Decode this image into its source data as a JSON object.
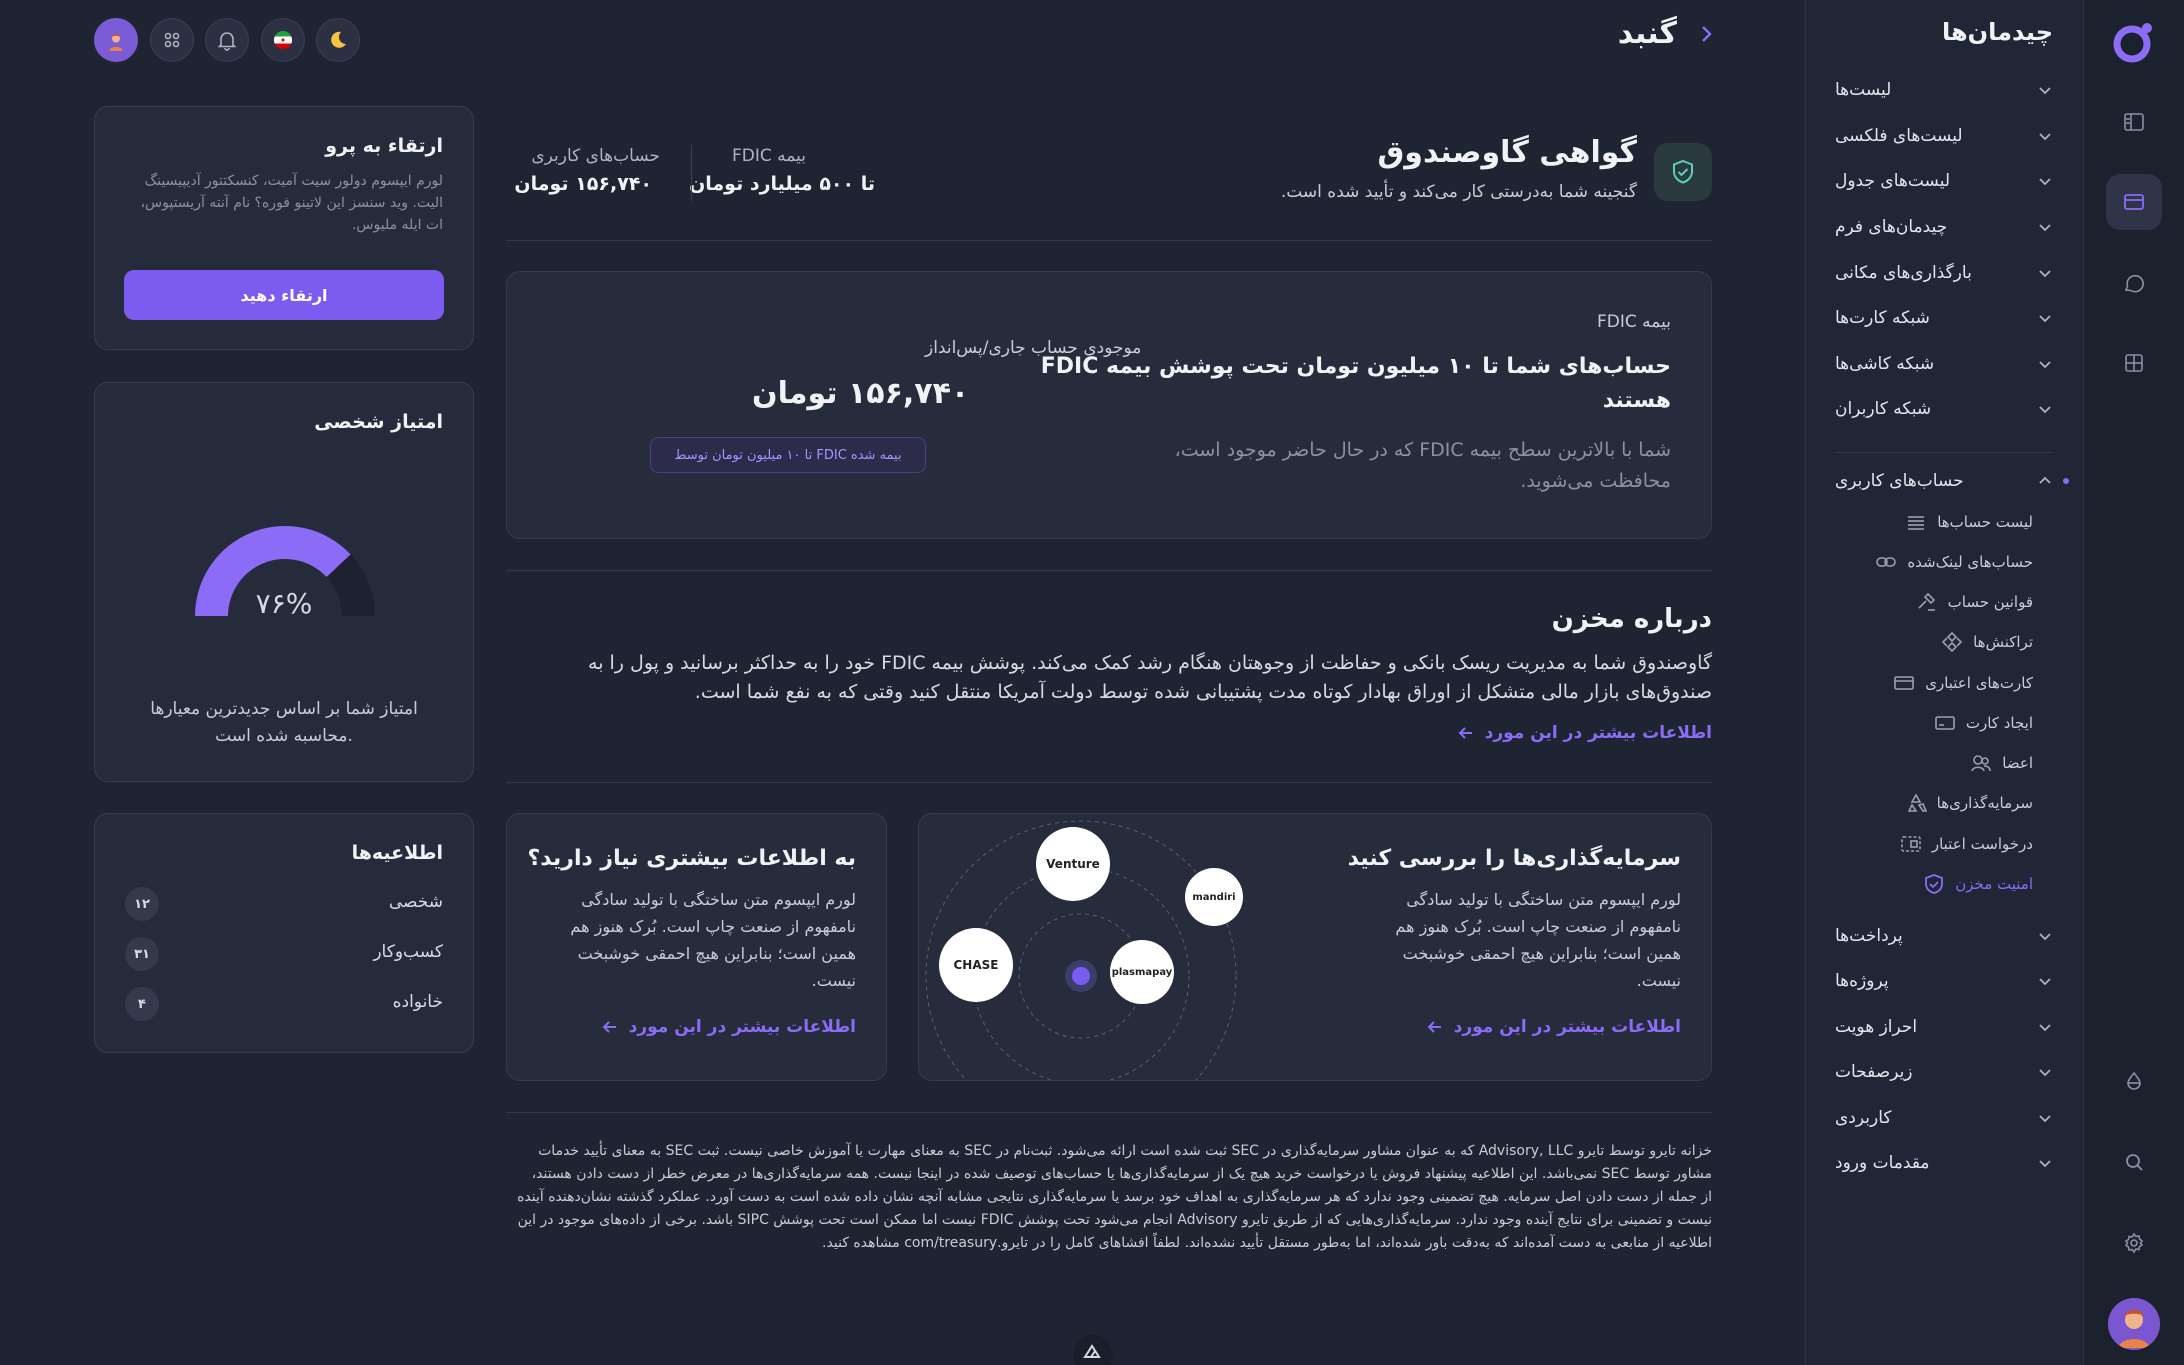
{
  "app": {
    "brand_color": "#8b6cf6"
  },
  "rail": {
    "icons": [
      "logo-icon",
      "layout-icon",
      "card-icon",
      "chat-icon",
      "grid-icon",
      "drop-icon",
      "search-icon",
      "settings-icon",
      "user-avatar"
    ]
  },
  "sidebar": {
    "title": "چیدمان‌ها",
    "items": [
      {
        "label": "لیست‌ها"
      },
      {
        "label": "لیست‌های فلکسی"
      },
      {
        "label": "لیست‌های جدول"
      },
      {
        "label": "چیدمان‌های فرم"
      },
      {
        "label": "بارگذاری‌های مکانی"
      },
      {
        "label": "شبکه کارت‌ها"
      },
      {
        "label": "شبکه کاشی‌ها"
      },
      {
        "label": "شبکه کاربران"
      }
    ],
    "open_group": {
      "label": "حساب‌های کاربری",
      "subitems": [
        {
          "label": "لیست حساب‌ها"
        },
        {
          "label": "حساب‌های لینک‌شده"
        },
        {
          "label": "قوانین حساب"
        },
        {
          "label": "تراکنش‌ها"
        },
        {
          "label": "کارت‌های اعتباری"
        },
        {
          "label": "ایجاد کارت"
        },
        {
          "label": "اعضا"
        },
        {
          "label": "سرمایه‌گذاری‌ها"
        },
        {
          "label": "درخواست اعتبار"
        },
        {
          "label": "امنیت مخزن"
        }
      ]
    },
    "bottom_items": [
      {
        "label": "پرداخت‌ها"
      },
      {
        "label": "پروژه‌ها"
      },
      {
        "label": "احراز هویت"
      },
      {
        "label": "زیرصفحات"
      },
      {
        "label": "کاربردی"
      },
      {
        "label": "مقدمات ورود"
      }
    ]
  },
  "header": {
    "title": "گنبد"
  },
  "certificate": {
    "title": "گواهی گاوصندوق",
    "subtitle": "گنجینه شما به‌درستی کار می‌کند و تأیید شده است.",
    "stat1_label": "بیمه FDIC",
    "stat1_value": "تا ۵۰۰ میلیارد تومان",
    "stat2_label": "حساب‌های کاربری",
    "stat2_value": "۱۵۶,۷۴۰ تومان"
  },
  "fdic": {
    "tag": "بیمه FDIC",
    "heading_line1": "حساب‌های شما تا ۱۰ میلیون تومان تحت پوشش بیمه FDIC",
    "heading_line2": "هستند",
    "desc_line1": "شما با بالاترین سطح بیمه FDIC که در حال حاضر موجود است،",
    "desc_line2": "محافظت می‌شوید.",
    "balance_label": "موجودی حساب جاری/پس‌انداز",
    "balance_value": "۱۵۶,۷۴۰ تومان",
    "pill": "تا ۱۰ میلیون تومان توسط FDIC بیمه شده"
  },
  "about": {
    "title": "درباره مخزن",
    "line1": "گاوصندوق شما به مدیریت ریسک بانکی و حفاظت از وجوهتان هنگام رشد کمک می‌کند. پوشش بیمه FDIC خود را به حداکثر برسانید و پول را به",
    "line2": "صندوق‌های بازار مالی متشکل از اوراق بهادار کوتاه مدت پشتیبانی شده توسط دولت آمریکا منتقل کنید وقتی که به نفع شما است.",
    "link": "اطلاعات بیشتر در این مورد"
  },
  "investments": {
    "title": "سرمایه‌گذاری‌ها را بررسی کنید",
    "l1": "لورم ایپسوم متن ساختگی با تولید سادگی",
    "l2": "نامفهوم از صنعت چاپ است. بُرک هنوز هم",
    "l3": "همین است؛ بنابراین هیچ احمقی خوشبخت",
    "l4": "نیست.",
    "link": "اطلاعات بیشتر در این مورد",
    "logos": [
      "Venture",
      "mandiri",
      "CHASE",
      "plasmapay"
    ]
  },
  "more_info": {
    "title": "به اطلاعات بیشتری نیاز دارید؟",
    "l1": "لورم ایپسوم متن ساختگی با تولید سادگی",
    "l2": "نامفهوم از صنعت چاپ است. بُرک هنوز هم",
    "l3": "همین است؛ بنابراین هیچ احمقی خوشبخت",
    "l4": "نیست.",
    "link": "اطلاعات بیشتر در این مورد"
  },
  "upgrade": {
    "title": "ارتقاء به پرو",
    "l1": "لورم ایپسوم دولور سیت آمیت، کنسکتتور آدیپیسینگ",
    "l2": "الیت. وید سنسز این لاتینو فوره؟ نام آنته آریستپوس،",
    "l3": "ات ایله ملیوس.",
    "button": "ارتقاء دهید"
  },
  "score": {
    "title": "امتیاز شخصی",
    "percent_text": "۷۶%",
    "percent": 76,
    "desc_l1": "امتیاز شما بر اساس جدیدترین معیارها",
    "desc_l2": "محاسبه شده است."
  },
  "info": {
    "title": "اطلاعیه‌ها",
    "rows": [
      {
        "label": "شخصی",
        "count": "۱۲"
      },
      {
        "label": "کسب‌وکار",
        "count": "۳۱"
      },
      {
        "label": "خانواده",
        "count": "۴"
      }
    ]
  },
  "disclaimer": {
    "l1": "خزانه تایرو توسط تایرو Advisory, LLC که به عنوان مشاور سرمایه‌گذاری در SEC ثبت شده است ارائه می‌شود. ثبت‌نام در SEC به معنای مهارت یا آموزش خاصی نیست. ثبت SEC به معنای تأیید خدمات",
    "l2": "مشاور توسط SEC نمی‌باشد. این اطلاعیه پیشنهاد فروش یا درخواست خرید هیچ یک از سرمایه‌گذاری‌ها یا حساب‌های توصیف شده در اینجا نیست. همه سرمایه‌گذاری‌ها در معرض خطر از دست دادن هستند،",
    "l3": "از جمله از دست دادن اصل سرمایه. هیچ تضمینی وجود ندارد که هر سرمایه‌گذاری به اهداف خود برسد یا سرمایه‌گذاری نتایجی مشابه آنچه نشان داده شده است به دست آورد. عملکرد گذشته نشان‌دهنده آینده",
    "l4": "نیست و تضمینی برای نتایج آینده وجود ندارد. سرمایه‌گذاری‌هایی که از طریق تایرو Advisory انجام می‌شود تحت پوشش FDIC نیست اما ممکن است تحت پوشش SIPC باشد. برخی از داده‌های موجود در این",
    "l5": "اطلاعیه از منابعی به دست آمده‌اند که به‌دقت باور شده‌اند، اما به‌طور مستقل تأیید نشده‌اند. لطفاً افشاهای کامل را در تایرو.com/treasury مشاهده کنید."
  }
}
